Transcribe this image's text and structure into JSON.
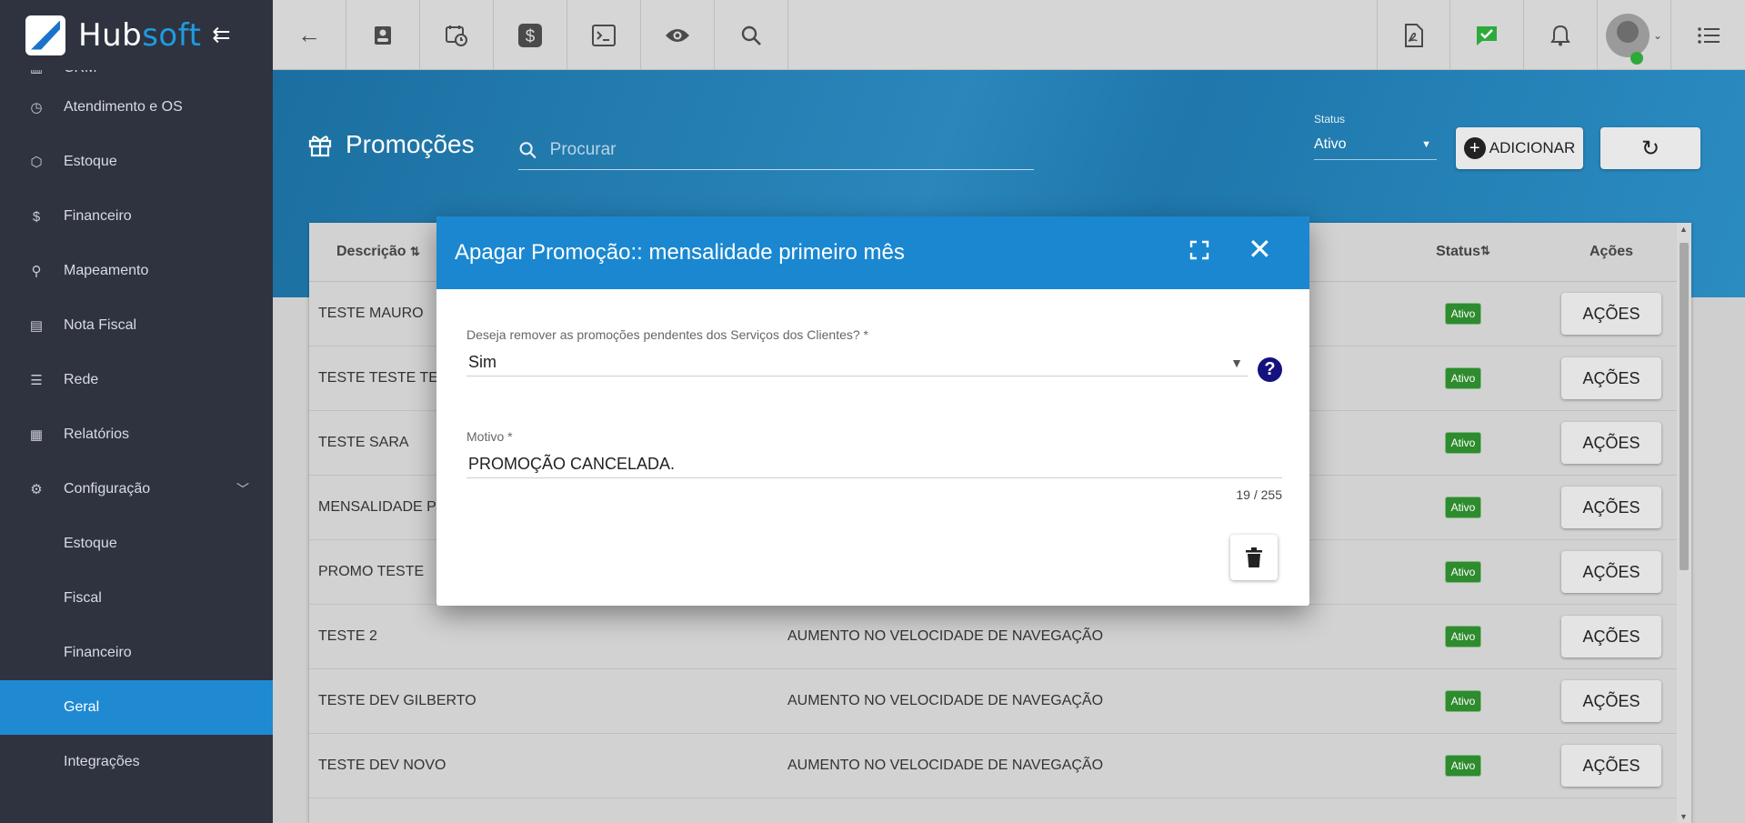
{
  "brand": {
    "name_a": "Hub",
    "name_b": "soft"
  },
  "sidebar": {
    "items": [
      {
        "label": "CRM"
      },
      {
        "label": "Atendimento e OS"
      },
      {
        "label": "Estoque"
      },
      {
        "label": "Financeiro"
      },
      {
        "label": "Mapeamento"
      },
      {
        "label": "Nota Fiscal"
      },
      {
        "label": "Rede"
      },
      {
        "label": "Relatórios"
      },
      {
        "label": "Configuração"
      },
      {
        "label": "Estoque"
      },
      {
        "label": "Fiscal"
      },
      {
        "label": "Financeiro"
      },
      {
        "label": "Geral"
      },
      {
        "label": "Integrações"
      }
    ]
  },
  "header": {
    "title": "Promoções",
    "search_placeholder": "Procurar",
    "status_label": "Status",
    "status_value": "Ativo",
    "add_label": "ADICIONAR"
  },
  "table": {
    "columns": {
      "descricao": "Descrição",
      "status": "Status",
      "acoes": "Ações"
    },
    "rows": [
      {
        "descricao": "TESTE MAURO",
        "obs": "",
        "status": "Ativo",
        "acoes": "AÇÕES"
      },
      {
        "descricao": "TESTE TESTE TES",
        "obs": "",
        "status": "Ativo",
        "acoes": "AÇÕES"
      },
      {
        "descricao": "TESTE SARA",
        "obs": "",
        "status": "Ativo",
        "acoes": "AÇÕES"
      },
      {
        "descricao": "MENSALIDADE PR",
        "obs": "",
        "status": "Ativo",
        "acoes": "AÇÕES"
      },
      {
        "descricao": "PROMO TESTE",
        "obs": "",
        "status": "Ativo",
        "acoes": "AÇÕES"
      },
      {
        "descricao": "TESTE 2",
        "obs": "AUMENTO NO VELOCIDADE DE NAVEGAÇÃO",
        "status": "Ativo",
        "acoes": "AÇÕES"
      },
      {
        "descricao": "TESTE DEV GILBERTO",
        "obs": "AUMENTO NO VELOCIDADE DE NAVEGAÇÃO",
        "status": "Ativo",
        "acoes": "AÇÕES"
      },
      {
        "descricao": "TESTE DEV NOVO",
        "obs": "AUMENTO NO VELOCIDADE DE NAVEGAÇÃO",
        "status": "Ativo",
        "acoes": "AÇÕES"
      }
    ]
  },
  "dialog": {
    "title": "Apagar Promoção:: mensalidade primeiro mês",
    "field1_label": "Deseja remover as promoções pendentes dos Serviços dos Clientes? *",
    "field1_value": "Sim",
    "field2_label": "Motivo *",
    "field2_value": "PROMOÇÃO CANCELADA.",
    "counter": "19 / 255",
    "help_glyph": "?"
  },
  "colors": {
    "accent": "#1a87d0",
    "sidebar": "#2f3340",
    "active": "#1f8ad2",
    "badge": "#2e8b2e"
  }
}
